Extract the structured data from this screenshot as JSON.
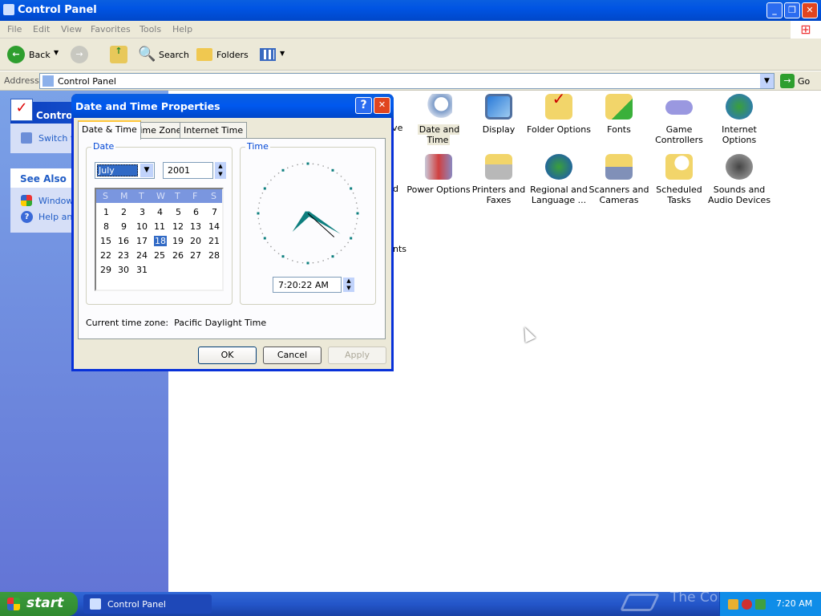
{
  "window": {
    "title": "Control Panel"
  },
  "menu": [
    "File",
    "Edit",
    "View",
    "Favorites",
    "Tools",
    "Help"
  ],
  "toolbar": {
    "back": "Back",
    "search": "Search",
    "folders": "Folders"
  },
  "address": {
    "label": "Address",
    "value": "Control Panel",
    "go": "Go"
  },
  "left_pane": {
    "title": "Control Panel",
    "switch": "Switch to Classic View",
    "see_also": "See Also",
    "links": [
      "Windows Update",
      "Help and Support"
    ]
  },
  "partial_items": [
    "ive",
    "d",
    "nts"
  ],
  "items_row1": [
    "Date and Time",
    "Display",
    "Folder Options",
    "Fonts",
    "Game Controllers",
    "Internet Options"
  ],
  "items_row2": [
    "Power Options",
    "Printers and Faxes",
    "Regional and Language ...",
    "Scanners and Cameras",
    "Scheduled Tasks",
    "Sounds and Audio Devices"
  ],
  "dialog": {
    "title": "Date and Time Properties",
    "tabs": [
      "Date & Time",
      "Time Zone",
      "Internet Time"
    ],
    "date_label": "Date",
    "time_label": "Time",
    "month": "July",
    "year": "2001",
    "weekdays": [
      "S",
      "M",
      "T",
      "W",
      "T",
      "F",
      "S"
    ],
    "days": [
      "1",
      "2",
      "3",
      "4",
      "5",
      "6",
      "7",
      "8",
      "9",
      "10",
      "11",
      "12",
      "13",
      "14",
      "15",
      "16",
      "17",
      "18",
      "19",
      "20",
      "21",
      "22",
      "23",
      "24",
      "25",
      "26",
      "27",
      "28",
      "29",
      "30",
      "31"
    ],
    "selected_day": "18",
    "time": "7:20:22 AM",
    "timezone_label": "Current time zone:",
    "timezone": "Pacific Daylight Time",
    "ok": "OK",
    "cancel": "Cancel",
    "apply": "Apply"
  },
  "taskbar": {
    "start": "start",
    "task": "Control Panel",
    "clock": "7:20 AM",
    "watermark": "The Collection Book"
  },
  "colors": {
    "title_blue": "#0054e3",
    "taskbar": "#245edb",
    "start_green": "#3c9a3c",
    "accent_teal": "#0e7f7f"
  }
}
